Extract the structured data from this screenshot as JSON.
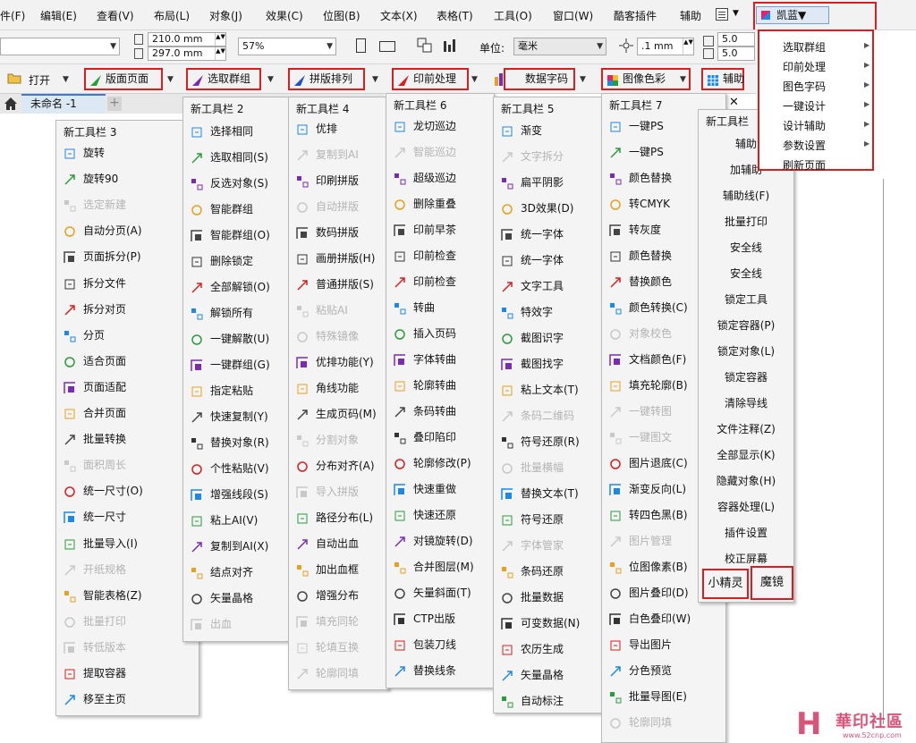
{
  "menubar": {
    "items": [
      "件(F)",
      "编辑(E)",
      "查看(V)",
      "布局(L)",
      "对象(J)",
      "效果(C)",
      "位图(B)",
      "文本(X)",
      "表格(T)",
      "工具(O)",
      "窗口(W)",
      "酷客插件",
      "辅助"
    ],
    "plugin_button": "凯蓝▼"
  },
  "propbar": {
    "width": "210.0 mm",
    "height": "297.0 mm",
    "zoom": "57%",
    "unit_label": "单位:",
    "unit_value": "毫米",
    "nudge": ".1 mm",
    "dup_x": "5.0",
    "dup_y": "5.0"
  },
  "toolbar": {
    "open": "打开",
    "buttons": [
      "版面页面",
      "选取群组",
      "拼版排列",
      "印前处理",
      "数据字码",
      "图像色彩",
      "辅助"
    ]
  },
  "tabbar": {
    "doc_tab": "未命名 -1",
    "add": "+"
  },
  "dropdown": {
    "items": [
      "选取群组",
      "印前处理",
      "图色字码",
      "一键设计",
      "设计辅助",
      "参数设置",
      "刷新页面"
    ]
  },
  "panels": {
    "p3": {
      "title": "新工具栏 3",
      "items": [
        {
          "label": "旋转",
          "enabled": true
        },
        {
          "label": "旋转90",
          "enabled": true
        },
        {
          "label": "选定新建",
          "enabled": false
        },
        {
          "label": "自动分页(A)",
          "enabled": true
        },
        {
          "label": "页面拆分(P)",
          "enabled": true
        },
        {
          "label": "拆分文件",
          "enabled": true
        },
        {
          "label": "拆分对页",
          "enabled": true
        },
        {
          "label": "分页",
          "enabled": true
        },
        {
          "label": "适合页面",
          "enabled": true
        },
        {
          "label": "页面适配",
          "enabled": true
        },
        {
          "label": "合并页面",
          "enabled": true
        },
        {
          "label": "批量转换",
          "enabled": true
        },
        {
          "label": "面积周长",
          "enabled": false
        },
        {
          "label": "统一尺寸(O)",
          "enabled": true
        },
        {
          "label": "统一尺寸",
          "enabled": true
        },
        {
          "label": "批量导入(I)",
          "enabled": true
        },
        {
          "label": "开纸规格",
          "enabled": false
        },
        {
          "label": "智能表格(Z)",
          "enabled": true
        },
        {
          "label": "批量打印",
          "enabled": false
        },
        {
          "label": "转低版本",
          "enabled": false
        },
        {
          "label": "提取容器",
          "enabled": true
        },
        {
          "label": "移至主页",
          "enabled": true
        }
      ]
    },
    "p2": {
      "title": "新工具栏 2",
      "items": [
        {
          "label": "选择相同",
          "enabled": true
        },
        {
          "label": "选取相同(S)",
          "enabled": true
        },
        {
          "label": "反选对象(S)",
          "enabled": true
        },
        {
          "label": "智能群组",
          "enabled": true
        },
        {
          "label": "智能群组(O)",
          "enabled": true
        },
        {
          "label": "删除锁定",
          "enabled": true
        },
        {
          "label": "全部解锁(O)",
          "enabled": true
        },
        {
          "label": "解锁所有",
          "enabled": true
        },
        {
          "label": "一键解散(U)",
          "enabled": true
        },
        {
          "label": "一键群组(G)",
          "enabled": true
        },
        {
          "label": "指定粘贴",
          "enabled": true
        },
        {
          "label": "快速复制(Y)",
          "enabled": true
        },
        {
          "label": "替换对象(R)",
          "enabled": true
        },
        {
          "label": "个性粘贴(V)",
          "enabled": true
        },
        {
          "label": "增强线段(S)",
          "enabled": true
        },
        {
          "label": "粘上AI(V)",
          "enabled": true
        },
        {
          "label": "复制到AI(X)",
          "enabled": true
        },
        {
          "label": "结点对齐",
          "enabled": true
        },
        {
          "label": "矢量晶格",
          "enabled": true
        },
        {
          "label": "出血",
          "enabled": false
        }
      ]
    },
    "p4": {
      "title": "新工具栏 4",
      "items": [
        {
          "label": "优排",
          "enabled": true
        },
        {
          "label": "复制到AI",
          "enabled": false
        },
        {
          "label": "印刷拼版",
          "enabled": true
        },
        {
          "label": "自动拼版",
          "enabled": false
        },
        {
          "label": "数码拼版",
          "enabled": true
        },
        {
          "label": "画册拼版(H)",
          "enabled": true
        },
        {
          "label": "普通拼版(S)",
          "enabled": true
        },
        {
          "label": "粘贴AI",
          "enabled": false
        },
        {
          "label": "特殊镜像",
          "enabled": false
        },
        {
          "label": "优排功能(Y)",
          "enabled": true
        },
        {
          "label": "角线功能",
          "enabled": true
        },
        {
          "label": "生成页码(M)",
          "enabled": true
        },
        {
          "label": "分割对象",
          "enabled": false
        },
        {
          "label": "分布对齐(A)",
          "enabled": true
        },
        {
          "label": "导入拼版",
          "enabled": false
        },
        {
          "label": "路径分布(L)",
          "enabled": true
        },
        {
          "label": "自动出血",
          "enabled": true
        },
        {
          "label": "加出血框",
          "enabled": true
        },
        {
          "label": "增强分布",
          "enabled": true
        },
        {
          "label": "填充同轮",
          "enabled": false
        },
        {
          "label": "轮填互换",
          "enabled": false
        },
        {
          "label": "轮廓同填",
          "enabled": false
        }
      ]
    },
    "p6": {
      "title": "新工具栏 6",
      "items": [
        {
          "label": "龙切巡边",
          "enabled": true
        },
        {
          "label": "智能巡边",
          "enabled": false
        },
        {
          "label": "超级巡边",
          "enabled": true
        },
        {
          "label": "删除重叠",
          "enabled": true
        },
        {
          "label": "印前早茶",
          "enabled": true
        },
        {
          "label": "印前检查",
          "enabled": true
        },
        {
          "label": "印前检查",
          "enabled": true
        },
        {
          "label": "转曲",
          "enabled": true
        },
        {
          "label": "插入页码",
          "enabled": true
        },
        {
          "label": "字体转曲",
          "enabled": true
        },
        {
          "label": "轮廓转曲",
          "enabled": true
        },
        {
          "label": "条码转曲",
          "enabled": true
        },
        {
          "label": "叠印陷印",
          "enabled": true
        },
        {
          "label": "轮廓修改(P)",
          "enabled": true
        },
        {
          "label": "快速重做",
          "enabled": true
        },
        {
          "label": "快速还原",
          "enabled": true
        },
        {
          "label": "对镜旋转(D)",
          "enabled": true
        },
        {
          "label": "合并图层(M)",
          "enabled": true
        },
        {
          "label": "矢量斜面(T)",
          "enabled": true
        },
        {
          "label": "CTP出版",
          "enabled": true
        },
        {
          "label": "包装刀线",
          "enabled": true
        },
        {
          "label": "替换线条",
          "enabled": true
        }
      ]
    },
    "p5": {
      "title": "新工具栏 5",
      "items": [
        {
          "label": "渐变",
          "enabled": true
        },
        {
          "label": "文字拆分",
          "enabled": false
        },
        {
          "label": "扁平阴影",
          "enabled": true
        },
        {
          "label": "3D效果(D)",
          "enabled": true
        },
        {
          "label": "统一字体",
          "enabled": true
        },
        {
          "label": "统一字体",
          "enabled": true
        },
        {
          "label": "文字工具",
          "enabled": true
        },
        {
          "label": "特效字",
          "enabled": true
        },
        {
          "label": "截图识字",
          "enabled": true
        },
        {
          "label": "截图找字",
          "enabled": true
        },
        {
          "label": "粘上文本(T)",
          "enabled": true
        },
        {
          "label": "条码二维码",
          "enabled": false
        },
        {
          "label": "符号还原(R)",
          "enabled": true
        },
        {
          "label": "批量横幅",
          "enabled": false
        },
        {
          "label": "替换文本(T)",
          "enabled": true
        },
        {
          "label": "符号还原",
          "enabled": true
        },
        {
          "label": "字体管家",
          "enabled": false
        },
        {
          "label": "条码还原",
          "enabled": true
        },
        {
          "label": "批量数据",
          "enabled": true
        },
        {
          "label": "可变数据(N)",
          "enabled": true
        },
        {
          "label": "农历生成",
          "enabled": true
        },
        {
          "label": "矢量晶格",
          "enabled": true
        },
        {
          "label": "自动标注",
          "enabled": true
        }
      ]
    },
    "p7": {
      "title": "新工具栏 7",
      "close": "✕",
      "items": [
        {
          "label": "一键PS",
          "enabled": true
        },
        {
          "label": "一键PS",
          "enabled": true
        },
        {
          "label": "颜色替换",
          "enabled": true
        },
        {
          "label": "转CMYK",
          "enabled": true
        },
        {
          "label": "转灰度",
          "enabled": true
        },
        {
          "label": "颜色替换",
          "enabled": true
        },
        {
          "label": "替换颜色",
          "enabled": true
        },
        {
          "label": "颜色转换(C)",
          "enabled": true
        },
        {
          "label": "对象校色",
          "enabled": false
        },
        {
          "label": "文档颜色(F)",
          "enabled": true
        },
        {
          "label": "填充轮廓(B)",
          "enabled": true
        },
        {
          "label": "一键转图",
          "enabled": false
        },
        {
          "label": "一键图文",
          "enabled": false
        },
        {
          "label": "图片退底(C)",
          "enabled": true
        },
        {
          "label": "渐变反向(L)",
          "enabled": true
        },
        {
          "label": "转四色黑(B)",
          "enabled": true
        },
        {
          "label": "图片管理",
          "enabled": false
        },
        {
          "label": "位图像素(B)",
          "enabled": true
        },
        {
          "label": "图片叠印(D)",
          "enabled": true
        },
        {
          "label": "白色叠印(W)",
          "enabled": true
        },
        {
          "label": "导出图片",
          "enabled": true
        },
        {
          "label": "分色预览",
          "enabled": true
        },
        {
          "label": "批量导图(E)",
          "enabled": true
        },
        {
          "label": "轮廓同填",
          "enabled": false
        }
      ]
    },
    "p8": {
      "title": "新工具栏",
      "items": [
        "辅助",
        "加辅助",
        "辅助线(F)",
        "批量打印",
        "安全线",
        "安全线",
        "锁定工具",
        "锁定容器(P)",
        "锁定对象(L)",
        "锁定容器",
        "清除导线",
        "文件注释(Z)",
        "全部显示(K)",
        "隐藏对象(H)",
        "容器处理(L)",
        "插件设置",
        "校正屏幕"
      ],
      "bottom_left": "小精灵",
      "bottom_right": "魔镜"
    }
  },
  "watermark": {
    "logo": "H",
    "text": "華印社區",
    "url": "www.52cnp.com"
  }
}
